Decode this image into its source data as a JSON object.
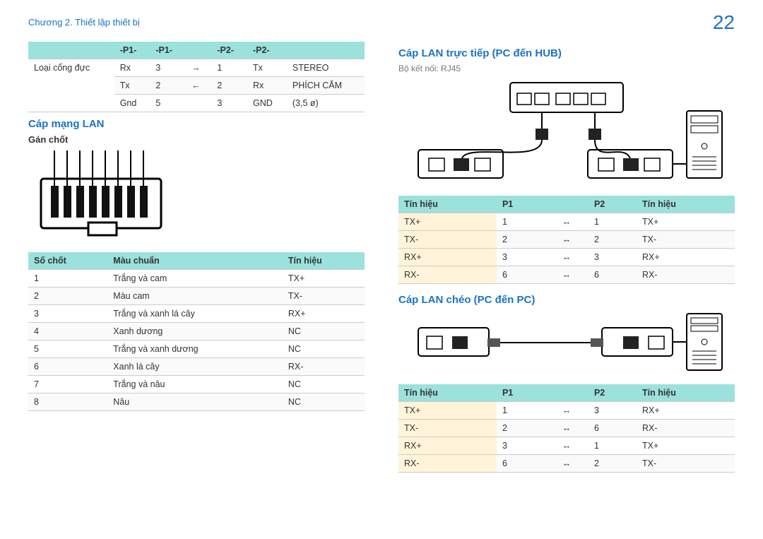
{
  "breadcrumb": "Chương 2. Thiết lập thiết bị",
  "page_number": "22",
  "left": {
    "table1": {
      "headers": [
        "-P1-",
        "-P1-",
        "",
        "-P2-",
        "-P2-",
        ""
      ],
      "row_label": "Loại cổng đực",
      "rows": [
        [
          "Rx",
          "3",
          "→",
          "1",
          "Tx",
          "STEREO"
        ],
        [
          "Tx",
          "2",
          "←",
          "2",
          "Rx",
          "PHÍCH CẮM"
        ],
        [
          "Gnd",
          "5",
          "",
          "3",
          "GND",
          "(3,5 ø)"
        ]
      ]
    },
    "sec1_title": "Cáp mạng LAN",
    "sec1_sub": "Gán chốt",
    "pin_table": {
      "headers": [
        "Số chốt",
        "Màu chuẩn",
        "Tín hiệu"
      ],
      "rows": [
        [
          "1",
          "Trắng và cam",
          "TX+"
        ],
        [
          "2",
          "Màu cam",
          "TX-"
        ],
        [
          "3",
          "Trắng và xanh lá cây",
          "RX+"
        ],
        [
          "4",
          "Xanh dương",
          "NC"
        ],
        [
          "5",
          "Trắng và xanh dương",
          "NC"
        ],
        [
          "6",
          "Xanh lá cây",
          "RX-"
        ],
        [
          "7",
          "Trắng và nâu",
          "NC"
        ],
        [
          "8",
          "Nâu",
          "NC"
        ]
      ]
    }
  },
  "right": {
    "sec2_title": "Cáp LAN trực tiếp (PC đến HUB)",
    "sec2_note": "Bộ kết nối: RJ45",
    "direct_table": {
      "headers": [
        "Tín hiệu",
        "P1",
        "",
        "P2",
        "Tín hiệu"
      ],
      "rows": [
        [
          "TX+",
          "1",
          "↔",
          "1",
          "TX+"
        ],
        [
          "TX-",
          "2",
          "↔",
          "2",
          "TX-"
        ],
        [
          "RX+",
          "3",
          "↔",
          "3",
          "RX+"
        ],
        [
          "RX-",
          "6",
          "↔",
          "6",
          "RX-"
        ]
      ]
    },
    "sec3_title": "Cáp LAN chéo (PC đến PC)",
    "cross_table": {
      "headers": [
        "Tín hiệu",
        "P1",
        "",
        "P2",
        "Tín hiệu"
      ],
      "rows": [
        [
          "TX+",
          "1",
          "↔",
          "3",
          "RX+"
        ],
        [
          "TX-",
          "2",
          "↔",
          "6",
          "RX-"
        ],
        [
          "RX+",
          "3",
          "↔",
          "1",
          "TX+"
        ],
        [
          "RX-",
          "6",
          "↔",
          "2",
          "TX-"
        ]
      ]
    }
  }
}
